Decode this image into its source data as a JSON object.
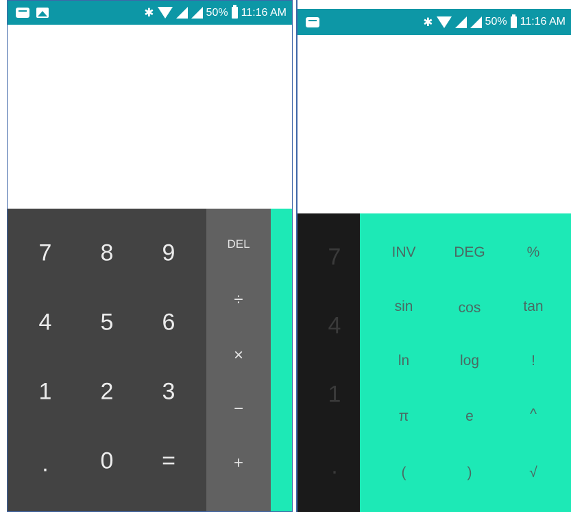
{
  "status_bar": {
    "battery": "50%",
    "time": "11:16 AM",
    "icons_left_screen": [
      "message-icon",
      "image-icon"
    ],
    "icons_right_screen": [
      "message-icon"
    ],
    "indicator_icons": [
      "bluetooth-icon",
      "wifi-icon",
      "signal-icon",
      "signal-icon",
      "battery-icon"
    ]
  },
  "left_screen": {
    "numpad": [
      "7",
      "8",
      "9",
      "4",
      "5",
      "6",
      "1",
      "2",
      "3",
      ".",
      "0",
      "="
    ],
    "ops": [
      "DEL",
      "÷",
      "×",
      "−",
      "+"
    ]
  },
  "right_screen": {
    "numpad_visible": [
      "7",
      "4",
      "1",
      "·"
    ],
    "advanced": [
      "INV",
      "DEG",
      "%",
      "sin",
      "cos",
      "tan",
      "ln",
      "log",
      "!",
      "π",
      "e",
      "^",
      "(",
      ")",
      "√"
    ]
  },
  "colors": {
    "status_bar": "#0d97a6",
    "numpad_bg": "#434343",
    "ops_bg": "#616161",
    "advanced_bg": "#1de9b6",
    "right_numpad_bg": "#1a1a1a",
    "display_bg": "#ffffff"
  }
}
